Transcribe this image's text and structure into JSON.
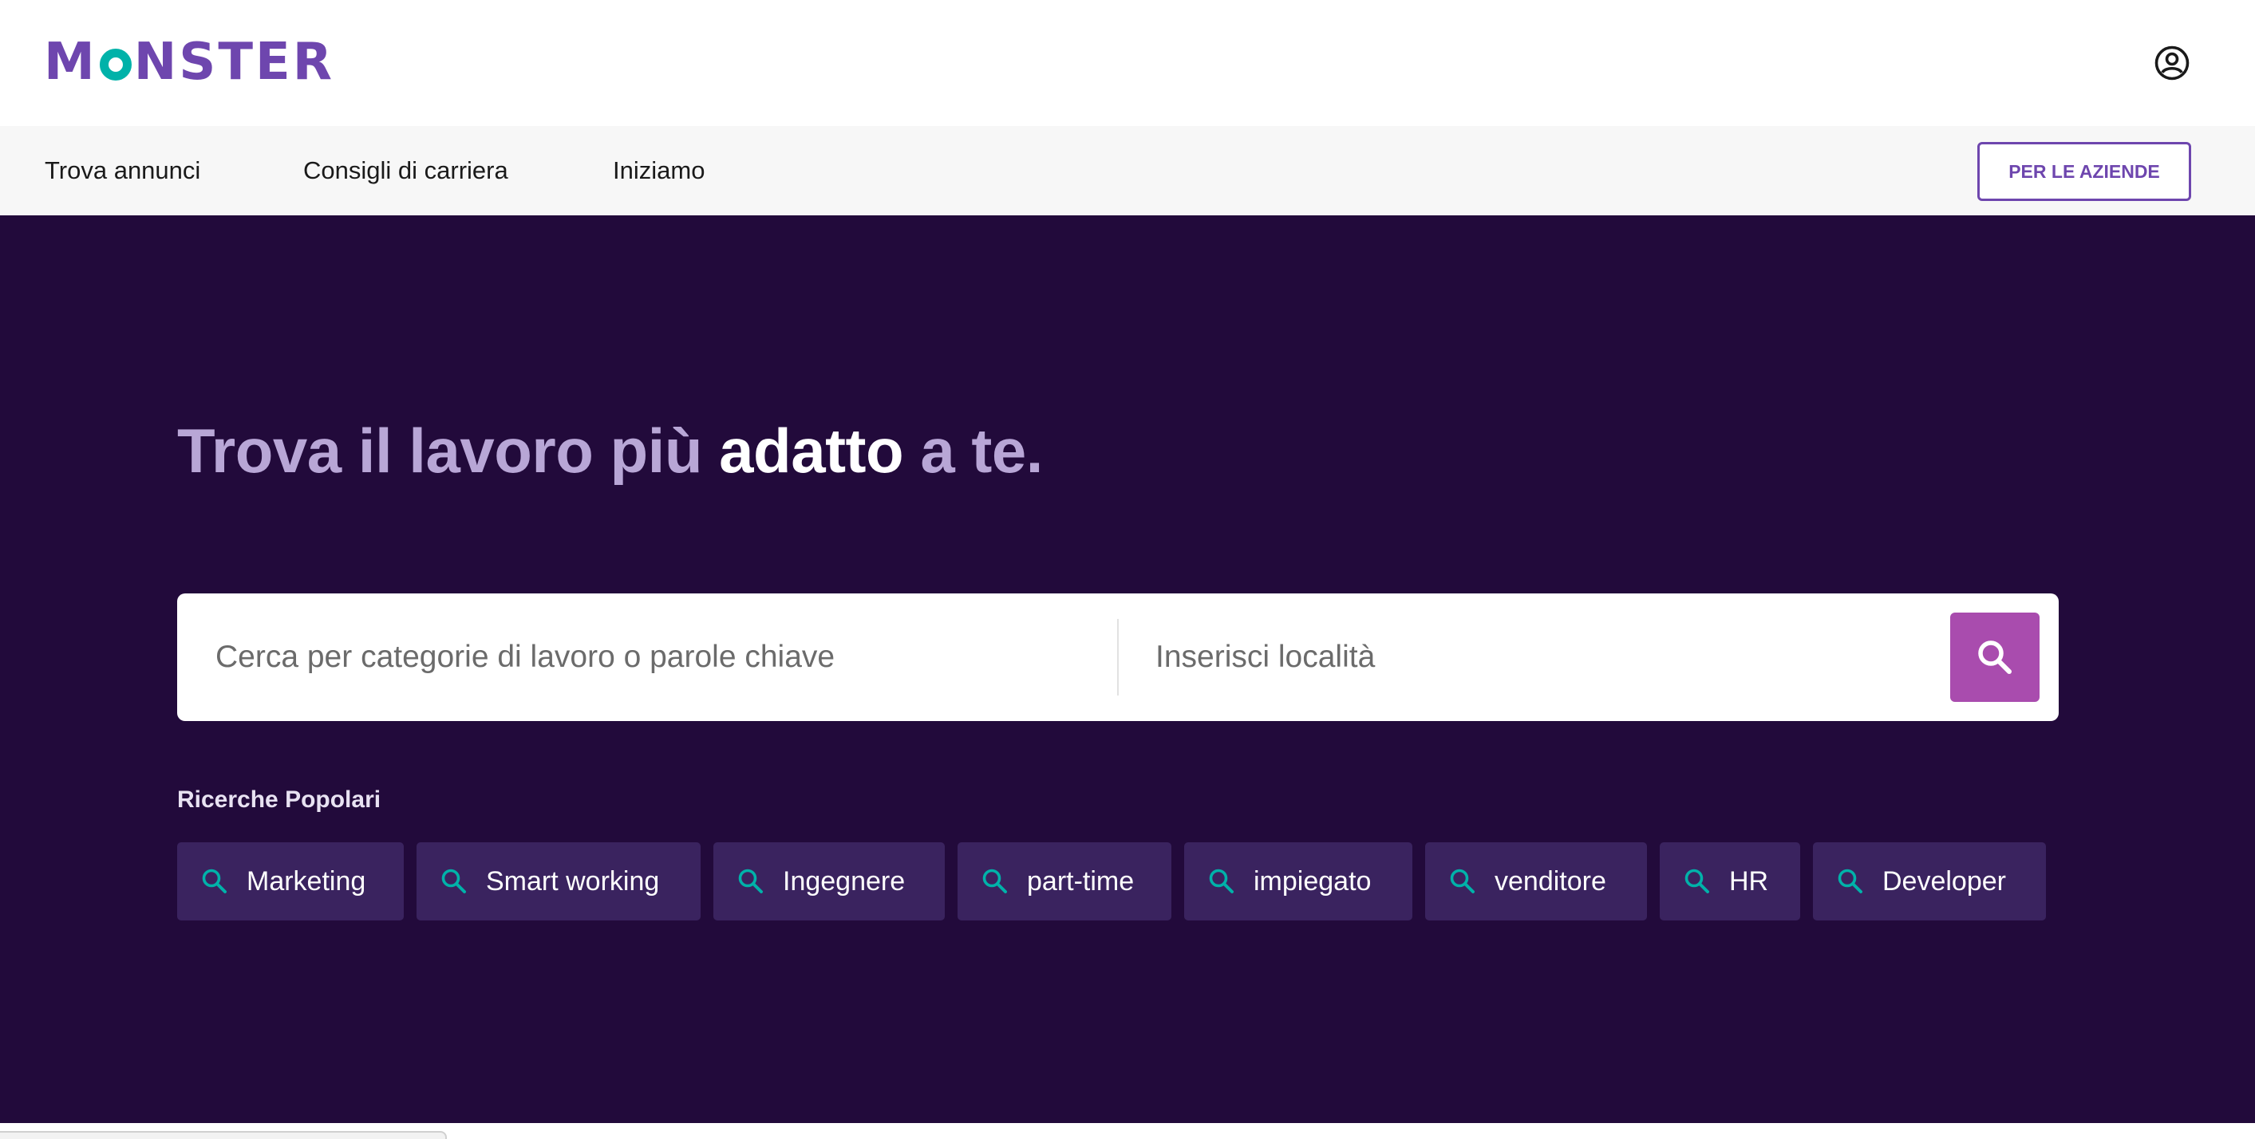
{
  "header": {
    "logo": {
      "text_before": "M",
      "text_after": "NSTER",
      "alt": "MONSTER"
    },
    "account_icon": "user-circle-icon"
  },
  "nav": {
    "items": [
      {
        "label": "Trova annunci"
      },
      {
        "label": "Consigli di carriera"
      },
      {
        "label": "Iniziamo"
      }
    ],
    "business_button": "PER LE AZIENDE"
  },
  "hero": {
    "headline_part1": "Trova il lavoro più ",
    "headline_accent": "adatto",
    "headline_part2": " a te.",
    "search": {
      "keyword_placeholder": "Cerca per categorie di lavoro o parole chiave",
      "keyword_value": "",
      "location_placeholder": "Inserisci località",
      "location_value": "",
      "button_icon": "search-icon"
    },
    "popular_label": "Ricerche Popolari",
    "popular_searches": [
      {
        "label": "Marketing"
      },
      {
        "label": "Smart working"
      },
      {
        "label": "Ingegnere"
      },
      {
        "label": "part-time"
      },
      {
        "label": "impiegato"
      },
      {
        "label": "venditore"
      },
      {
        "label": "HR"
      },
      {
        "label": "Developer"
      }
    ]
  },
  "colors": {
    "brand_purple": "#6e46ae",
    "brand_teal": "#00b2a9",
    "hero_background": "#220a3b",
    "headline_muted": "#b8a6d6",
    "search_button": "#a94cae",
    "chip_background": "#3a235f"
  }
}
